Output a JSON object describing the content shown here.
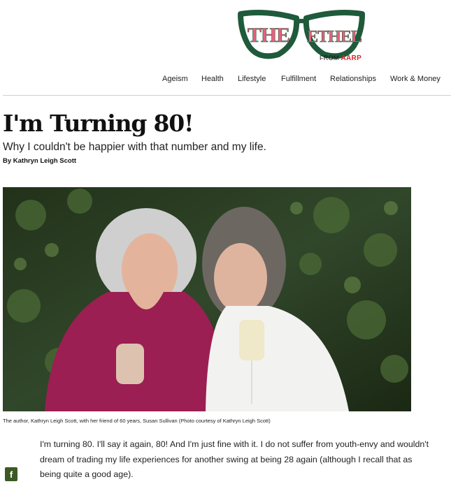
{
  "brand": {
    "logo_left": "THE",
    "logo_right": "ETHEL",
    "from_text": "FROM",
    "from_brand": "AARP",
    "colors": {
      "frame": "#1f5a3a",
      "lens_letters": "#e8607e",
      "aarp": "#d8262e"
    }
  },
  "nav": {
    "items": [
      {
        "label": "Ageism"
      },
      {
        "label": "Health"
      },
      {
        "label": "Lifestyle"
      },
      {
        "label": "Fulfillment"
      },
      {
        "label": "Relationships"
      },
      {
        "label": "Work & Money"
      }
    ]
  },
  "article": {
    "headline": "I'm Turning 80!",
    "dek": "Why I couldn't be happier with that number and my life.",
    "byline": "By Kathryn Leigh Scott",
    "photo_caption": "The author, Kathryn Leigh Scott, with her friend of 60 years, Susan Sullivan (Photo courtesy of Kathryn Leigh Scott)",
    "body_paragraph": "I'm turning 80. I'll say it again, 80! And I'm just fine with it. I do not suffer from youth-envy and wouldn't dream of trading my life experiences for another swing at being 28 again (although I recall that as being quite a good age)."
  },
  "share": {
    "facebook_glyph": "f",
    "icon": "facebook-icon",
    "color": "#3b5a23"
  }
}
